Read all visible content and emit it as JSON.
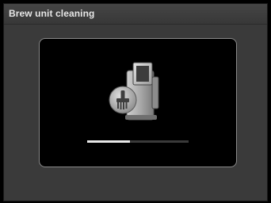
{
  "header": {
    "title": "Brew unit cleaning"
  },
  "status": {
    "progress_fraction": 0.42
  },
  "icons": {
    "illustration": "brew-unit-icon",
    "badge": "cleaning-brush-icon"
  },
  "colors": {
    "screen_background": "#3a3a3a",
    "panel_background": "#000000",
    "panel_border": "#8a8a8a",
    "progress_fill": "#e8e8e8",
    "progress_track": "#3a3a3a",
    "title_text": "#e6e6e6"
  }
}
